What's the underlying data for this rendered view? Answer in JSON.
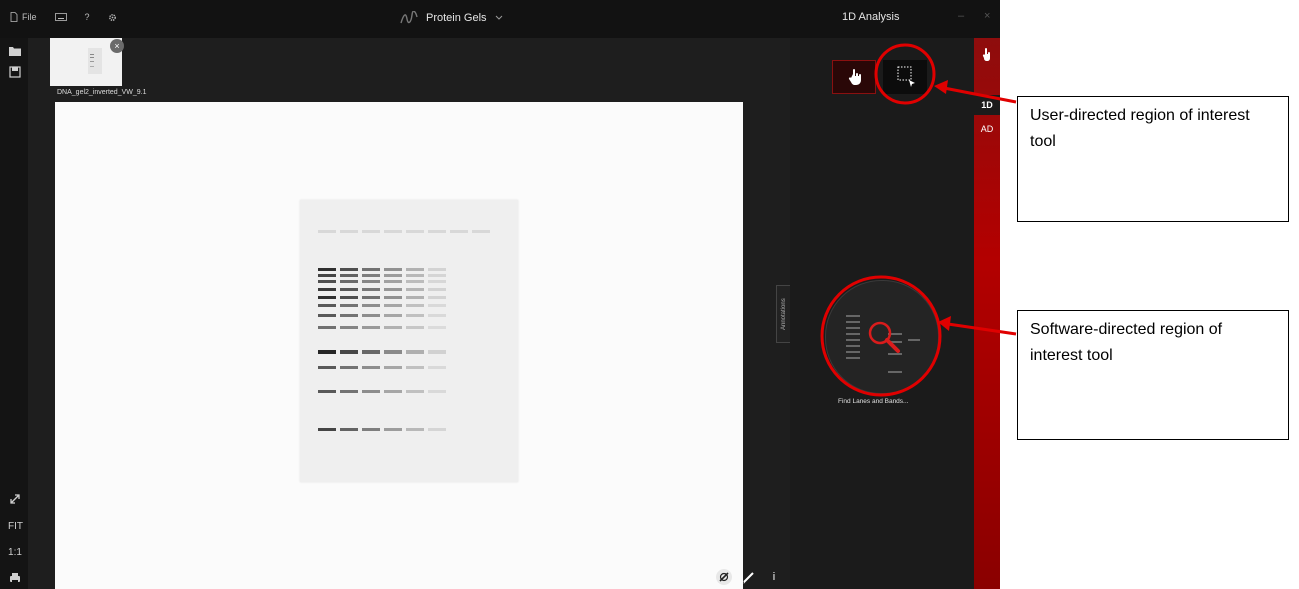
{
  "titlebar": {
    "file_label": "File",
    "help_label": "?",
    "app_title": "Protein Gels",
    "mode_title": "1D Analysis",
    "minimize": "–",
    "close": "×"
  },
  "thumbnail": {
    "label": "DNA_gel2_inverted_VW_9.1",
    "close_glyph": "×"
  },
  "left_tools": {
    "fit_label": "FIT",
    "one_to_one_label": "1:1"
  },
  "annotations_tab": "Annotations",
  "find_lanes_label": "Find Lanes and Bands...",
  "side_tabs": {
    "tab_1d": "1D",
    "tab_ad": "AD"
  },
  "bottom_tools": {
    "info_glyph": "i"
  },
  "callouts": {
    "user_roi": "User-directed region of interest tool",
    "software_roi": "Software-directed region of interest tool"
  },
  "colors": {
    "accent_red": "#b30000",
    "annotation_red": "#e00000",
    "app_bg": "#141414"
  }
}
